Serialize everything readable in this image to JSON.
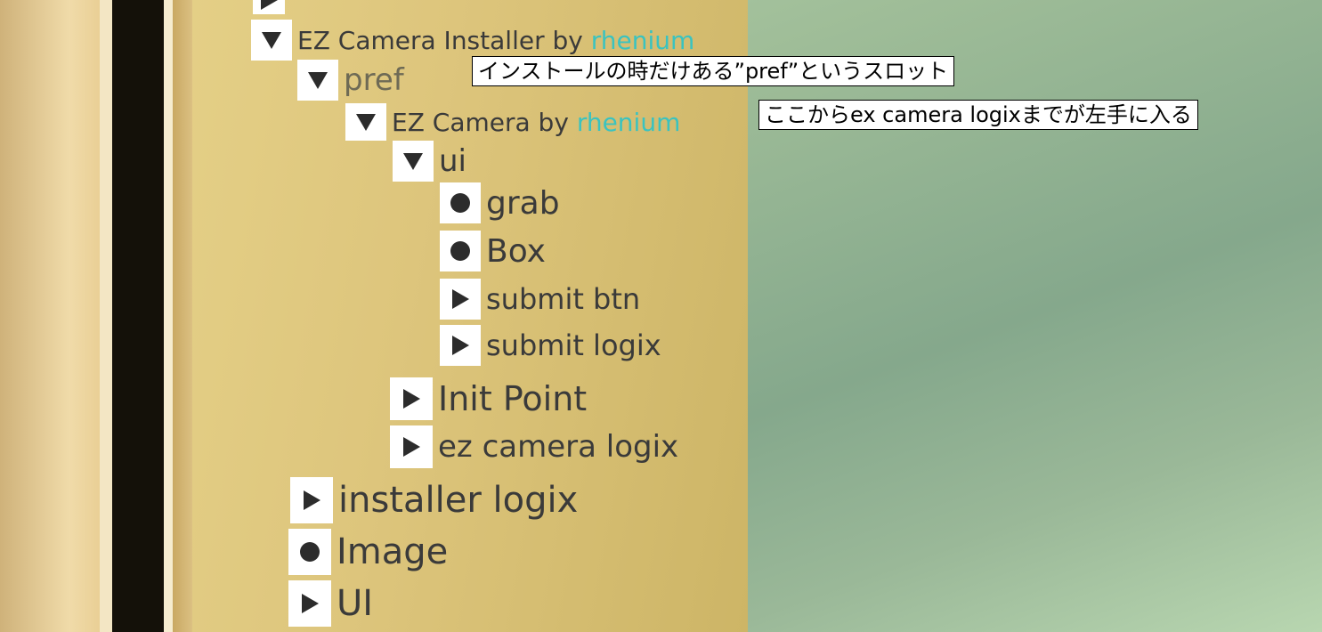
{
  "tree": {
    "installer_prefix": "EZ Camera Installer by ",
    "installer_author": "rhenium",
    "pref": "pref",
    "camera_prefix": "EZ Camera by ",
    "camera_author": "rhenium",
    "ui": "ui",
    "grab": "grab",
    "box": "Box",
    "submit_btn": "submit btn",
    "submit_logix": "submit logix",
    "init_point": "Init Point",
    "ez_camera_logix": "ez camera logix",
    "installer_logix": "installer logix",
    "image": "Image",
    "UI": "UI"
  },
  "annotations": {
    "pref_note": "インストールの時だけある”pref”というスロット",
    "camera_note": "ここからex camera logixまでが左手に入る"
  },
  "colors": {
    "accent": "#3ac3c0",
    "panel": "#ddc57c",
    "background": "#9fbd98"
  },
  "icons": [
    "expanded-triangle-icon",
    "collapsed-triangle-icon",
    "leaf-dot-icon"
  ]
}
